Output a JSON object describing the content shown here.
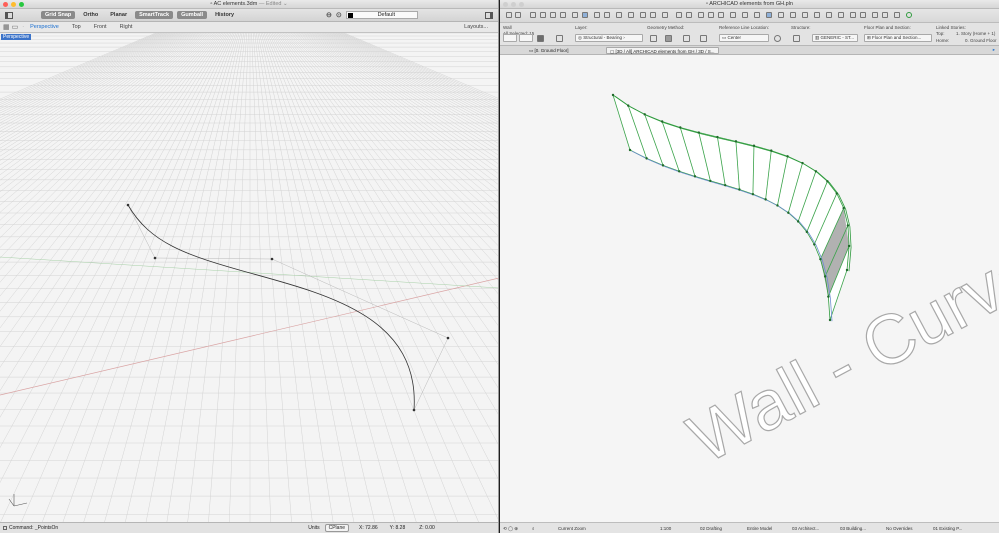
{
  "rhino": {
    "title": "AC elements.3dm",
    "title_suffix": "— Edited ⌄",
    "toolbar": {
      "grid_snap": "Grid Snap",
      "ortho": "Ortho",
      "planar": "Planar",
      "smarttrack": "SmartTrack",
      "gumball": "Gumball",
      "history": "History",
      "layer": "Default"
    },
    "tabs": [
      "Perspective",
      "Top",
      "Front",
      "Right"
    ],
    "layouts": "Layouts...",
    "viewport_label": "Perspective",
    "status": {
      "command": "Command: _PointsOn",
      "units": "Units",
      "cplane": "CPlane",
      "x": "X: 72.86",
      "y": "Y: 8.28",
      "z": "Z: 0.00"
    }
  },
  "archicad": {
    "title": "ARCHICAD elements from GH.pln",
    "info": {
      "tool": "Wall",
      "selected": "All Selected: 15",
      "layer_label": "Layer:",
      "layer_value": "Structural - Bearing",
      "geometry_label": "Geometry Method:",
      "refline_label": "Reference Line Location:",
      "refline_value": "Center",
      "structure_label": "Structure:",
      "structure_value": "GENERIC - ST...",
      "floorplan_label": "Floor Plan and Section:",
      "floorplan_value": "Floor Plan and Section...",
      "linked_label": "Linked Stories:",
      "top_label": "Top:",
      "top_value": "1. Story (Home + 1)",
      "home_label": "Home:",
      "home_value": "0. Ground Floor"
    },
    "doc_tabs": [
      "[0. Ground Floor]",
      "[3D / All] ARCHICAD elements from GH / 3D / S..."
    ],
    "watermark": "Wall - Curve",
    "status": {
      "zoom": "Current Zoom",
      "scale": "1:100",
      "layer_combo": "02 Drafting",
      "model": "Entire Model",
      "view": "03 Architect...",
      "building": "03 Building...",
      "overrides": "No Overrides",
      "existing": "01 Existing P..."
    }
  }
}
